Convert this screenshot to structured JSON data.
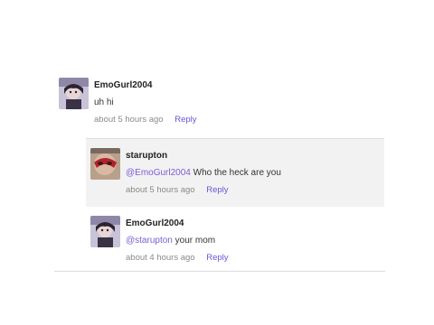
{
  "comments": [
    {
      "username": "EmoGurl2004",
      "text": "uh hi",
      "time": "about 5 hours ago",
      "reply_label": "Reply",
      "avatar_icon": "emo-avatar-icon"
    }
  ],
  "replies": [
    {
      "username": "starupton",
      "mention": "@EmoGurl2004",
      "text": " Who the heck are you",
      "time": "about 5 hours ago",
      "reply_label": "Reply",
      "avatar_icon": "masked-avatar-icon"
    },
    {
      "username": "EmoGurl2004",
      "mention": "@starupton",
      "text": " your mom",
      "time": "about 4 hours ago",
      "reply_label": "Reply",
      "avatar_icon": "emo-avatar-icon"
    }
  ],
  "colors": {
    "link": "#6a55d8",
    "meta": "#8a8a8a",
    "reply_bg": "#f2f2f2"
  }
}
